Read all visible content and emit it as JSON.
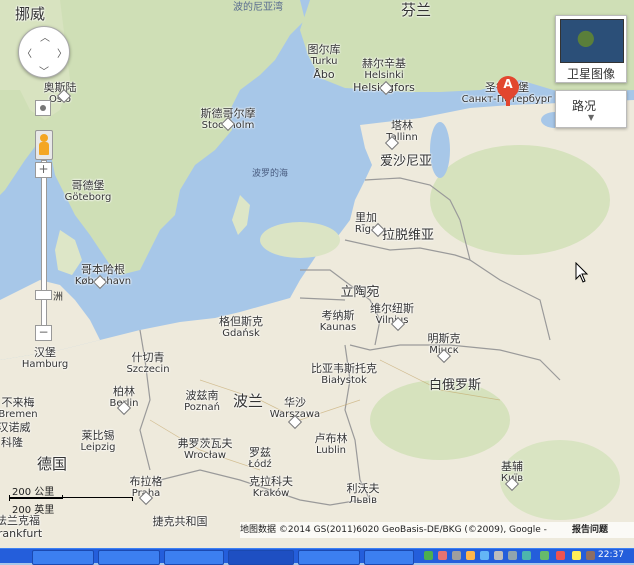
{
  "map": {
    "labels": [
      {
        "text": "挪威",
        "sub": ""
      },
      {
        "text": "芬兰",
        "sub": ""
      },
      {
        "text": "波的尼亚湾",
        "sub": ""
      },
      {
        "text": "图尔库",
        "sub": "Turku"
      },
      {
        "text": "赫尔辛基",
        "sub": "Helsinki"
      },
      {
        "text": "Helsingfors",
        "sub": ""
      },
      {
        "text": "圣彼得堡",
        "sub": "Санкт-Петербург"
      },
      {
        "text": "奥斯陆",
        "sub": "Oslo"
      },
      {
        "text": "斯德哥尔摩",
        "sub": "Stockholm"
      },
      {
        "text": "塔林",
        "sub": "Tallinn"
      },
      {
        "text": "爱沙尼亚",
        "sub": ""
      },
      {
        "text": "波罗的海",
        "sub": ""
      },
      {
        "text": "哥德堡",
        "sub": "Göteborg"
      },
      {
        "text": "里加",
        "sub": "Rīga"
      },
      {
        "text": "拉脱维亚",
        "sub": ""
      },
      {
        "text": "哥本哈根",
        "sub": "København"
      },
      {
        "text": "立陶宛",
        "sub": ""
      },
      {
        "text": "格但斯克",
        "sub": "Gdańsk"
      },
      {
        "text": "考纳斯",
        "sub": "Kaunas"
      },
      {
        "text": "维尔纽斯",
        "sub": "Vilnius"
      },
      {
        "text": "明斯克",
        "sub": "Мінск"
      },
      {
        "text": "汉堡",
        "sub": "Hamburg"
      },
      {
        "text": "什切青",
        "sub": "Szczecin"
      },
      {
        "text": "比亚韦斯托克",
        "sub": "Białystok"
      },
      {
        "text": "白俄罗斯",
        "sub": ""
      },
      {
        "text": "不来梅",
        "sub": "Bremen"
      },
      {
        "text": "柏林",
        "sub": "Berlin"
      },
      {
        "text": "波兹南",
        "sub": "Poznań"
      },
      {
        "text": "波兰",
        "sub": ""
      },
      {
        "text": "华沙",
        "sub": "Warszawa"
      },
      {
        "text": "汉诺威",
        "sub": ""
      },
      {
        "text": "莱比锡",
        "sub": "Leipzig"
      },
      {
        "text": "弗罗茨瓦夫",
        "sub": "Wrocław"
      },
      {
        "text": "卢布林",
        "sub": "Lublin"
      },
      {
        "text": "德国",
        "sub": ""
      },
      {
        "text": "罗兹",
        "sub": "Łódź"
      },
      {
        "text": "基辅",
        "sub": "Київ"
      },
      {
        "text": "科隆",
        "sub": ""
      },
      {
        "text": "布拉格",
        "sub": "Praha"
      },
      {
        "text": "克拉科夫",
        "sub": "Kraków"
      },
      {
        "text": "利沃夫",
        "sub": "Львів"
      },
      {
        "text": "捷克共和国",
        "sub": ""
      },
      {
        "text": "法兰克福",
        "sub": ""
      },
      {
        "text": "rankfurt",
        "sub": ""
      },
      {
        "text": "Åbo",
        "sub": ""
      }
    ],
    "marker_letter": "A"
  },
  "controls": {
    "zoom_in": "+",
    "zoom_out": "−",
    "zoom_label": "洲",
    "satellite_label": "卫星图像",
    "traffic_label": "路况",
    "traffic_caret": "▼"
  },
  "scale": {
    "km": "200 公里",
    "mi": "200 英里"
  },
  "attribution": {
    "text": "地图数据 ©2014 GS(2011)6020 GeoBasis-DE/BKG (©2009), Google -",
    "report": "报告问题"
  },
  "taskbar": {
    "clock": "22:37"
  },
  "colors": {
    "water": "#a7c7e8",
    "land": "#eeeadc",
    "forest": "#c8dbb0",
    "border": "#9a9a9a",
    "marker": "#e2462f",
    "taskbar": "#245edb"
  }
}
